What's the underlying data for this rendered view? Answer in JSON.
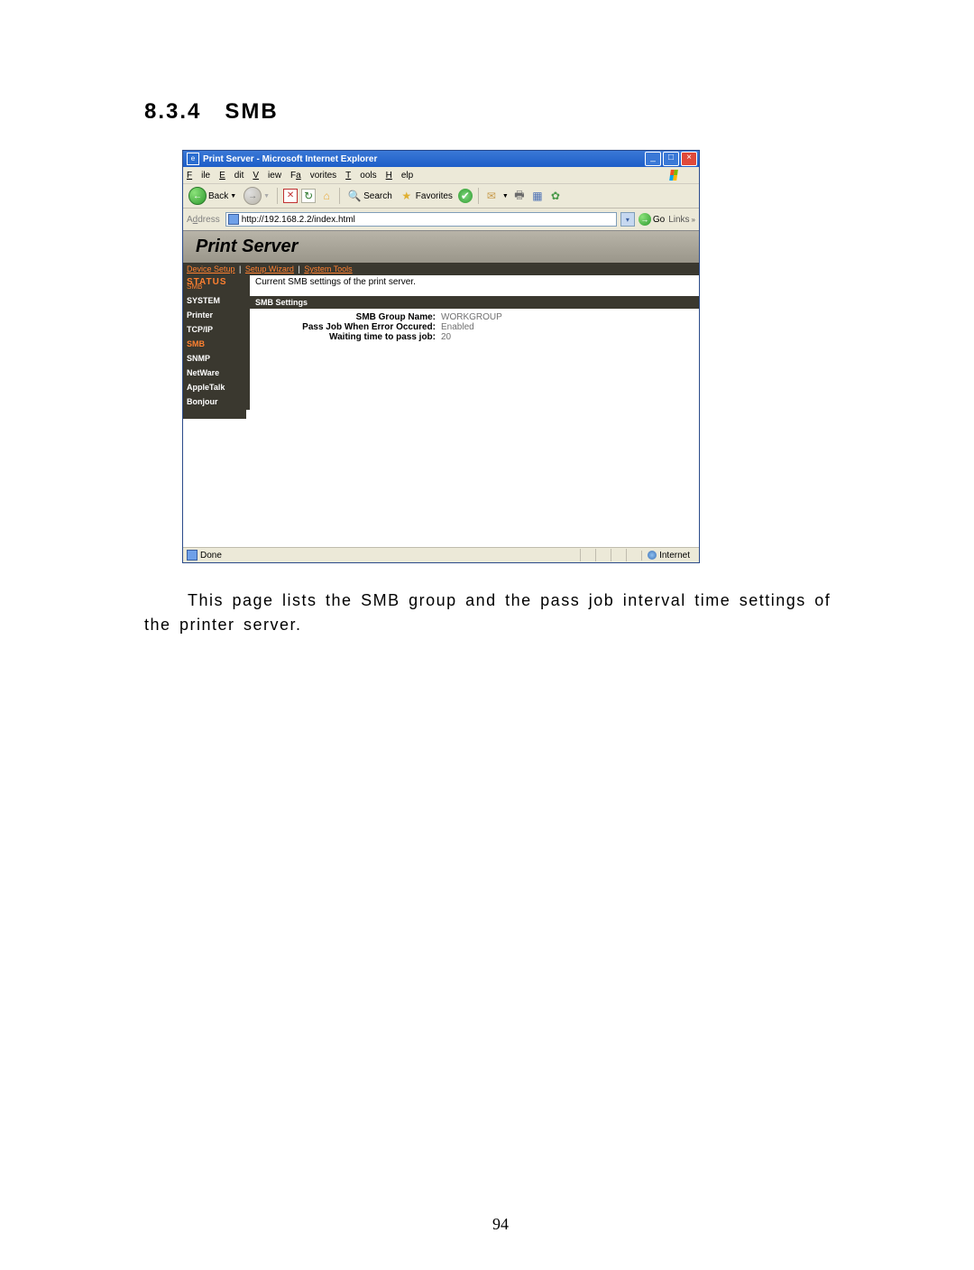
{
  "document": {
    "section_number": "8.3.4",
    "section_title": "SMB",
    "description": "This page lists the SMB group and the pass job interval time settings of the printer server.",
    "page_number": "94"
  },
  "browser": {
    "window_title": "Print Server - Microsoft Internet Explorer",
    "menus": {
      "file": "File",
      "edit": "Edit",
      "view": "View",
      "favorites": "Favorites",
      "tools": "Tools",
      "help": "Help"
    },
    "toolbar": {
      "back": "Back",
      "search": "Search",
      "favorites": "Favorites"
    },
    "address_label": "Address",
    "url": "http://192.168.2.2/index.html",
    "go": "Go",
    "links": "Links",
    "status_text": "Done",
    "zone": "Internet"
  },
  "print_server": {
    "header": "Print Server",
    "nav": {
      "device_setup": "Device Setup",
      "setup_wizard": "Setup Wizard",
      "system_tools": "System Tools"
    },
    "sidebar": {
      "status": "STATUS",
      "status_sub": "SMB",
      "items": [
        "SYSTEM",
        "Printer",
        "TCP/IP",
        "SMB",
        "SNMP",
        "NetWare",
        "AppleTalk",
        "Bonjour"
      ],
      "active_index": 3
    },
    "intro": "Current SMB settings of the print server.",
    "section_title": "SMB Settings",
    "settings": [
      {
        "label": "SMB Group Name:",
        "value": "WORKGROUP"
      },
      {
        "label": "Pass Job When Error Occured:",
        "value": "Enabled"
      },
      {
        "label": "Waiting time to pass job:",
        "value": "20"
      }
    ]
  }
}
